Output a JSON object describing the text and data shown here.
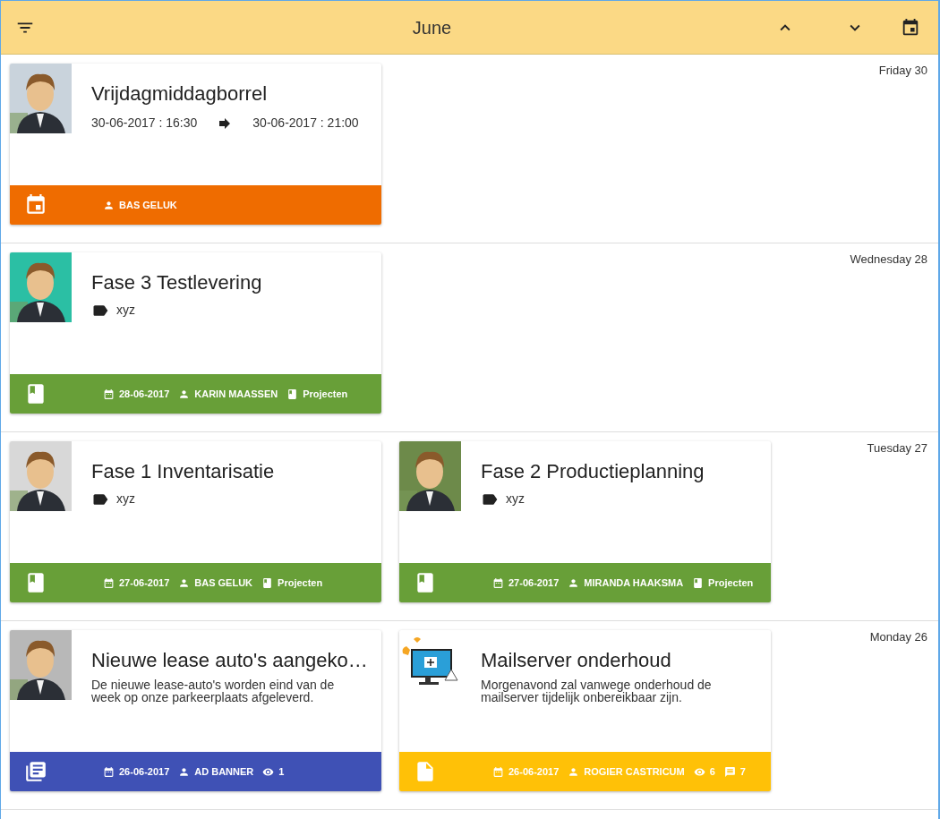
{
  "header": {
    "title": "June"
  },
  "days": [
    {
      "label": "Friday 30",
      "cards": [
        {
          "kind": "event",
          "color": "#ef6c00",
          "image": {
            "kind": "picture"
          },
          "title": "Vrijdagmiddagborrel",
          "start": "30-06-2017 : 16:30",
          "end": "30-06-2017 : 21:00",
          "meta": [
            {
              "kind": "person",
              "text": "BAS GELUK"
            }
          ]
        }
      ]
    },
    {
      "label": "Wednesday 28",
      "cards": [
        {
          "kind": "project",
          "color": "#689f38",
          "image": {
            "kind": "picture"
          },
          "title": "Fase 3 Testlevering",
          "tag": "xyz",
          "meta": [
            {
              "kind": "date",
              "text": "28-06-2017"
            },
            {
              "kind": "person",
              "text": "KARIN MAASSEN"
            },
            {
              "kind": "category",
              "text": "Projecten"
            }
          ]
        }
      ]
    },
    {
      "label": "Tuesday 27",
      "cards": [
        {
          "kind": "project",
          "color": "#689f38",
          "image": {
            "kind": "picture"
          },
          "title": "Fase 1 Inventarisatie",
          "tag": "xyz",
          "meta": [
            {
              "kind": "date",
              "text": "27-06-2017"
            },
            {
              "kind": "person",
              "text": "BAS GELUK"
            },
            {
              "kind": "category",
              "text": "Projecten"
            }
          ]
        },
        {
          "kind": "project",
          "color": "#689f38",
          "image": {
            "kind": "picture"
          },
          "title": "Fase 2 Productieplanning",
          "tag": "xyz",
          "meta": [
            {
              "kind": "date",
              "text": "27-06-2017"
            },
            {
              "kind": "person",
              "text": "MIRANDA HAAKSMA"
            },
            {
              "kind": "category",
              "text": "Projecten"
            }
          ]
        }
      ]
    },
    {
      "label": "Monday 26",
      "cards": [
        {
          "kind": "news",
          "color": "#3f51b5",
          "image": {
            "kind": "picture"
          },
          "title": "Nieuwe lease auto's aangeko…",
          "description": "De nieuwe lease-auto's worden eind van de week op onze parkeerplaats afgeleverd.",
          "meta": [
            {
              "kind": "date",
              "text": "26-06-2017"
            },
            {
              "kind": "person",
              "text": "AD BANNER"
            },
            {
              "kind": "views",
              "text": "1"
            }
          ]
        },
        {
          "kind": "document",
          "color": "#ffc107",
          "image": {
            "kind": "illustration"
          },
          "title": "Mailserver onderhoud",
          "description": "Morgenavond zal vanwege onderhoud de mailserver tijdelijk onbereikbaar zijn.",
          "meta": [
            {
              "kind": "date",
              "text": "26-06-2017"
            },
            {
              "kind": "person",
              "text": "ROGIER CASTRICUM"
            },
            {
              "kind": "views",
              "text": "6"
            },
            {
              "kind": "comments",
              "text": "7"
            }
          ]
        }
      ]
    }
  ]
}
